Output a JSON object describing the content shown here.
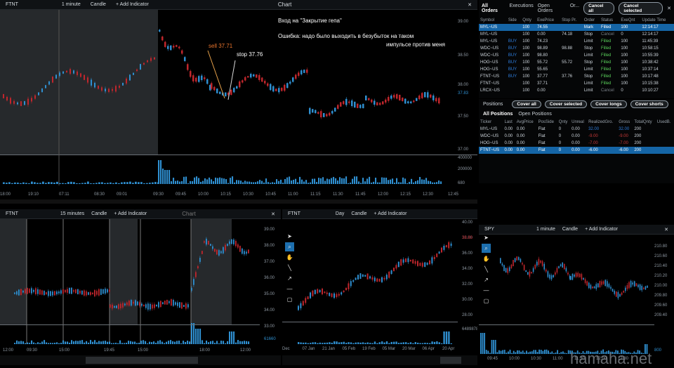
{
  "main": {
    "symbol": "FTNT",
    "interval": "1 minute",
    "type": "Candle",
    "add_indicator": "+ Add Indicator",
    "title": "Chart",
    "y_ticks": [
      "39.00",
      "38.50",
      "38.00",
      "37.83",
      "37.50",
      "37.00"
    ],
    "vol_ticks": [
      "400000",
      "200000",
      "680"
    ],
    "x_ticks": [
      "18:00",
      "19:10",
      "07:11",
      "08:30",
      "09:01",
      "09:30",
      "09:45",
      "10:00",
      "10:15",
      "10:30",
      "10:45",
      "11:00",
      "11:15",
      "11:30",
      "11:45",
      "12:00",
      "12:15",
      "12:30",
      "12:45"
    ],
    "annotation_title": "Вход на \"Закрытие гепа\"",
    "annotation_error": "Ошибка: надо было выходить в безубыток на таком",
    "annotation_error2": "импульсе против меня",
    "sell_label": "sell 37.71",
    "stop_label": "stop 37.76"
  },
  "orders": {
    "tabs": [
      "All Orders",
      "Executions",
      "Open Orders",
      "Or..."
    ],
    "cancel_all": "Cancel all",
    "cancel_selected": "Cancel selected",
    "columns": [
      "Symbol",
      "Side",
      "Qnty",
      "ExePrice",
      "Stop Pr.",
      "Order",
      "Status",
      "ExeQnt",
      "Update Time"
    ],
    "rows": [
      [
        "MYL~US",
        "",
        "100",
        "74.55",
        "",
        "Mark",
        "Filled",
        "100",
        "12:14:17"
      ],
      [
        "MYL~US",
        "",
        "100",
        "0.00",
        "74.18",
        "Stop",
        "Cancel",
        "0",
        "12:14:17"
      ],
      [
        "MYL~US",
        "BUY",
        "100",
        "74.23",
        "",
        "Limit",
        "Filled",
        "100",
        "11:45:39"
      ],
      [
        "WDC~US",
        "BUY",
        "100",
        "98.89",
        "98.88",
        "Stop",
        "Filled",
        "100",
        "10:58:15"
      ],
      [
        "WDC~US",
        "BUY",
        "100",
        "98.80",
        "",
        "Limit",
        "Filled",
        "100",
        "10:55:39"
      ],
      [
        "HOG~US",
        "BUY",
        "100",
        "55.72",
        "55.72",
        "Stop",
        "Filled",
        "100",
        "10:38:42"
      ],
      [
        "HOG~US",
        "BUY",
        "100",
        "55.65",
        "",
        "Limit",
        "Filled",
        "100",
        "10:37:14"
      ],
      [
        "FTNT~US",
        "BUY",
        "100",
        "37.77",
        "37.76",
        "Stop",
        "Filled",
        "100",
        "10:17:48"
      ],
      [
        "FTNT~US",
        "",
        "100",
        "37.71",
        "",
        "Limit",
        "Filled",
        "100",
        "10:15:38"
      ],
      [
        "LRCX~US",
        "",
        "100",
        "0.00",
        "",
        "Limit",
        "Cancel",
        "0",
        "10:10:27"
      ]
    ]
  },
  "positions": {
    "title": "Positions",
    "cover_all": "Cover all",
    "cover_selected": "Cover selected",
    "cover_longs": "Cover longs",
    "cover_shorts": "Cover shorts",
    "tabs": [
      "All Positions",
      "Open Positions"
    ],
    "columns": [
      "Ticker",
      "Last",
      "AvgPrice",
      "PosSide",
      "Qnty",
      "Unreal",
      "RealizedGro.",
      "Gross",
      "TotalQnty",
      "UsedB."
    ],
    "rows": [
      [
        "MYL~US",
        "0.00",
        "0.00",
        "Flat",
        "0",
        "0.00",
        "32.00",
        "32.00",
        "200",
        ""
      ],
      [
        "WDC~US",
        "0.00",
        "0.00",
        "Flat",
        "0",
        "0.00",
        "-9.00",
        "-9.00",
        "200",
        ""
      ],
      [
        "HOG~US",
        "0.00",
        "0.00",
        "Flat",
        "0",
        "0.00",
        "-7.00",
        "-7.00",
        "200",
        ""
      ],
      [
        "FTNT~US",
        "0.00",
        "0.00",
        "Flat",
        "0",
        "0.00",
        "-6.00",
        "-6.00",
        "200",
        ""
      ]
    ]
  },
  "chart2": {
    "symbol": "FTNT",
    "interval": "15 minutes",
    "type": "Candle",
    "add_indicator": "+ Add Indicator",
    "title": "Chart",
    "y_ticks": [
      "39.00",
      "38.00",
      "37.00",
      "36.00",
      "35.00",
      "34.00",
      "33.00"
    ],
    "x_ticks": [
      "12:00",
      "09:30",
      "15:00",
      "19:45",
      "15:00",
      "18:00",
      "12:00"
    ],
    "vol": "61660"
  },
  "chart3": {
    "symbol": "FTNT",
    "interval": "Day",
    "type": "Candle",
    "add_indicator": "+ Add Indicator",
    "y_ticks": [
      "40.00",
      "38.00",
      "36.00",
      "34.00",
      "32.00",
      "30.00",
      "28.00"
    ],
    "x_ticks": [
      "Dec",
      "07 Jan",
      "21 Jan",
      "05 Feb",
      "19 Feb",
      "05 Mar",
      "20 Mar",
      "06 Apr",
      "20 Apr"
    ],
    "vol": "6489878",
    "last": "38.83"
  },
  "chart4": {
    "symbol": "SPY",
    "interval": "1 minute",
    "type": "Candle",
    "add_indicator": "+ Add Indicator",
    "y_ticks": [
      "210.80",
      "210.60",
      "210.40",
      "210.20",
      "210.00",
      "209.80",
      "209.60",
      "209.40"
    ],
    "x_ticks": [
      "09:45",
      "10:00",
      "10:30",
      "11:00",
      "11:30",
      "12:00",
      "12:30"
    ],
    "vol": "800"
  },
  "watermark": "hamaha.net",
  "colors": {
    "bg": "#000000",
    "up": "#2f8fd0",
    "down": "#c0272d",
    "accent": "#1565a6"
  }
}
